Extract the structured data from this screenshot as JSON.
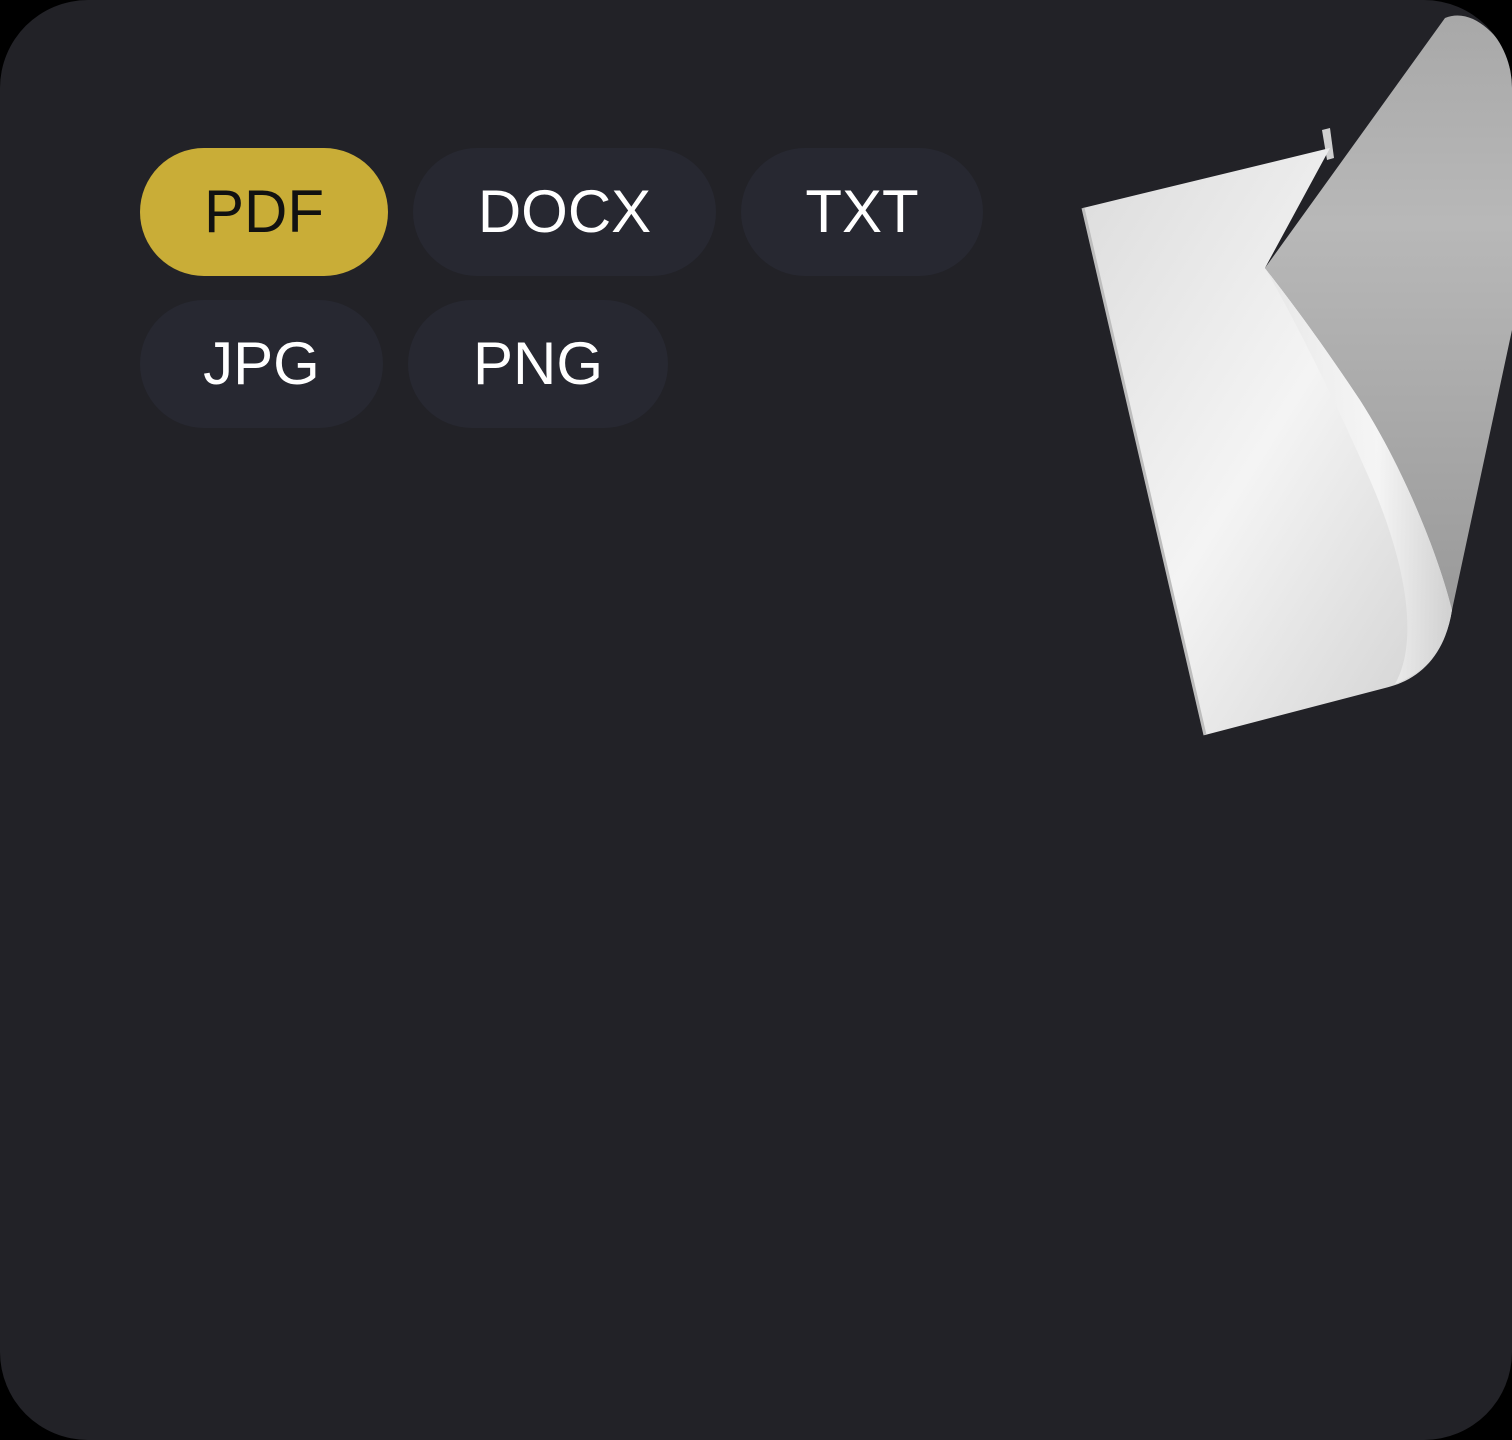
{
  "format_chips": [
    {
      "label": "PDF",
      "selected": true
    },
    {
      "label": "DOCX",
      "selected": false
    },
    {
      "label": "TXT",
      "selected": false
    },
    {
      "label": "JPG",
      "selected": false
    },
    {
      "label": "PNG",
      "selected": false
    }
  ],
  "colors": {
    "background": "#222227",
    "chip_background": "#272831",
    "chip_selected_background": "#c9ad37",
    "chip_text": "#ffffff",
    "chip_selected_text": "#111111"
  },
  "illustration": {
    "icon": "curled-paper-sheet-icon"
  }
}
